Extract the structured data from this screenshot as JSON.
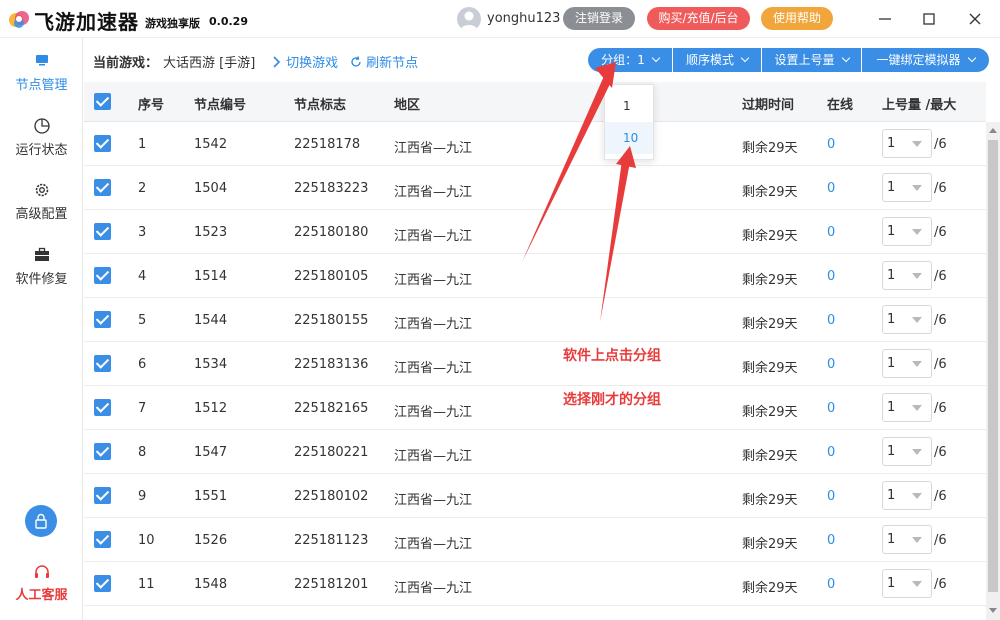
{
  "app": {
    "title": "飞游加速器",
    "subtitle": "游戏独享版",
    "version": "0.0.29",
    "username": "yonghu123",
    "buttons": {
      "logout": "注销登录",
      "buy": "购买/充值/后台",
      "help": "使用帮助"
    }
  },
  "sidebar": {
    "items": [
      {
        "label": "节点管理",
        "icon": "monitor-icon",
        "active": true
      },
      {
        "label": "运行状态",
        "icon": "pie-chart-icon",
        "active": false
      },
      {
        "label": "高级配置",
        "icon": "gear-icon",
        "active": false
      },
      {
        "label": "软件修复",
        "icon": "toolbox-icon",
        "active": false
      }
    ],
    "service": "人工客服"
  },
  "toolbar": {
    "current_game_label": "当前游戏：",
    "current_game_value": "大话西游 [手游]",
    "switch_game": "切换游戏",
    "refresh_node": "刷新节点",
    "group_label": "分组：",
    "group_value": "1",
    "order_mode": "顺序模式",
    "setup_count": "设置上号量",
    "bind_emulator": "一键绑定模拟器"
  },
  "dropdown": {
    "options": [
      "1",
      "10"
    ],
    "highlighted": "10"
  },
  "table": {
    "headers": {
      "index": "序号",
      "node_id": "节点编号",
      "node_tag": "节点标志",
      "region": "地区",
      "expire": "过期时间",
      "online": "在线",
      "limit": "上号量 /最大"
    },
    "rows": [
      {
        "index": "1",
        "node_id": "1542",
        "node_tag": "22518178",
        "region": "江西省—九江",
        "expire": "剩余29天",
        "online": "0",
        "count": "1",
        "max": "/6"
      },
      {
        "index": "2",
        "node_id": "1504",
        "node_tag": "225183223",
        "region": "江西省—九江",
        "expire": "剩余29天",
        "online": "0",
        "count": "1",
        "max": "/6"
      },
      {
        "index": "3",
        "node_id": "1523",
        "node_tag": "225180180",
        "region": "江西省—九江",
        "expire": "剩余29天",
        "online": "0",
        "count": "1",
        "max": "/6"
      },
      {
        "index": "4",
        "node_id": "1514",
        "node_tag": "225180105",
        "region": "江西省—九江",
        "expire": "剩余29天",
        "online": "0",
        "count": "1",
        "max": "/6"
      },
      {
        "index": "5",
        "node_id": "1544",
        "node_tag": "225180155",
        "region": "江西省—九江",
        "expire": "剩余29天",
        "online": "0",
        "count": "1",
        "max": "/6"
      },
      {
        "index": "6",
        "node_id": "1534",
        "node_tag": "225183136",
        "region": "江西省—九江",
        "expire": "剩余29天",
        "online": "0",
        "count": "1",
        "max": "/6"
      },
      {
        "index": "7",
        "node_id": "1512",
        "node_tag": "225182165",
        "region": "江西省—九江",
        "expire": "剩余29天",
        "online": "0",
        "count": "1",
        "max": "/6"
      },
      {
        "index": "8",
        "node_id": "1547",
        "node_tag": "225180221",
        "region": "江西省—九江",
        "expire": "剩余29天",
        "online": "0",
        "count": "1",
        "max": "/6"
      },
      {
        "index": "9",
        "node_id": "1551",
        "node_tag": "225180102",
        "region": "江西省—九江",
        "expire": "剩余29天",
        "online": "0",
        "count": "1",
        "max": "/6"
      },
      {
        "index": "10",
        "node_id": "1526",
        "node_tag": "225181123",
        "region": "江西省—九江",
        "expire": "剩余29天",
        "online": "0",
        "count": "1",
        "max": "/6"
      },
      {
        "index": "11",
        "node_id": "1548",
        "node_tag": "225181201",
        "region": "江西省—九江",
        "expire": "剩余29天",
        "online": "0",
        "count": "1",
        "max": "/6"
      }
    ]
  },
  "annotation": {
    "line1": "软件上点击分组",
    "line2": "选择刚才的分组",
    "color": "#e83c3c"
  },
  "colors": {
    "accent": "#3a8ee6",
    "link": "#2e8ce6",
    "danger": "#ef5b5b",
    "warning": "#f0a63a",
    "muted": "#8b8f94"
  }
}
